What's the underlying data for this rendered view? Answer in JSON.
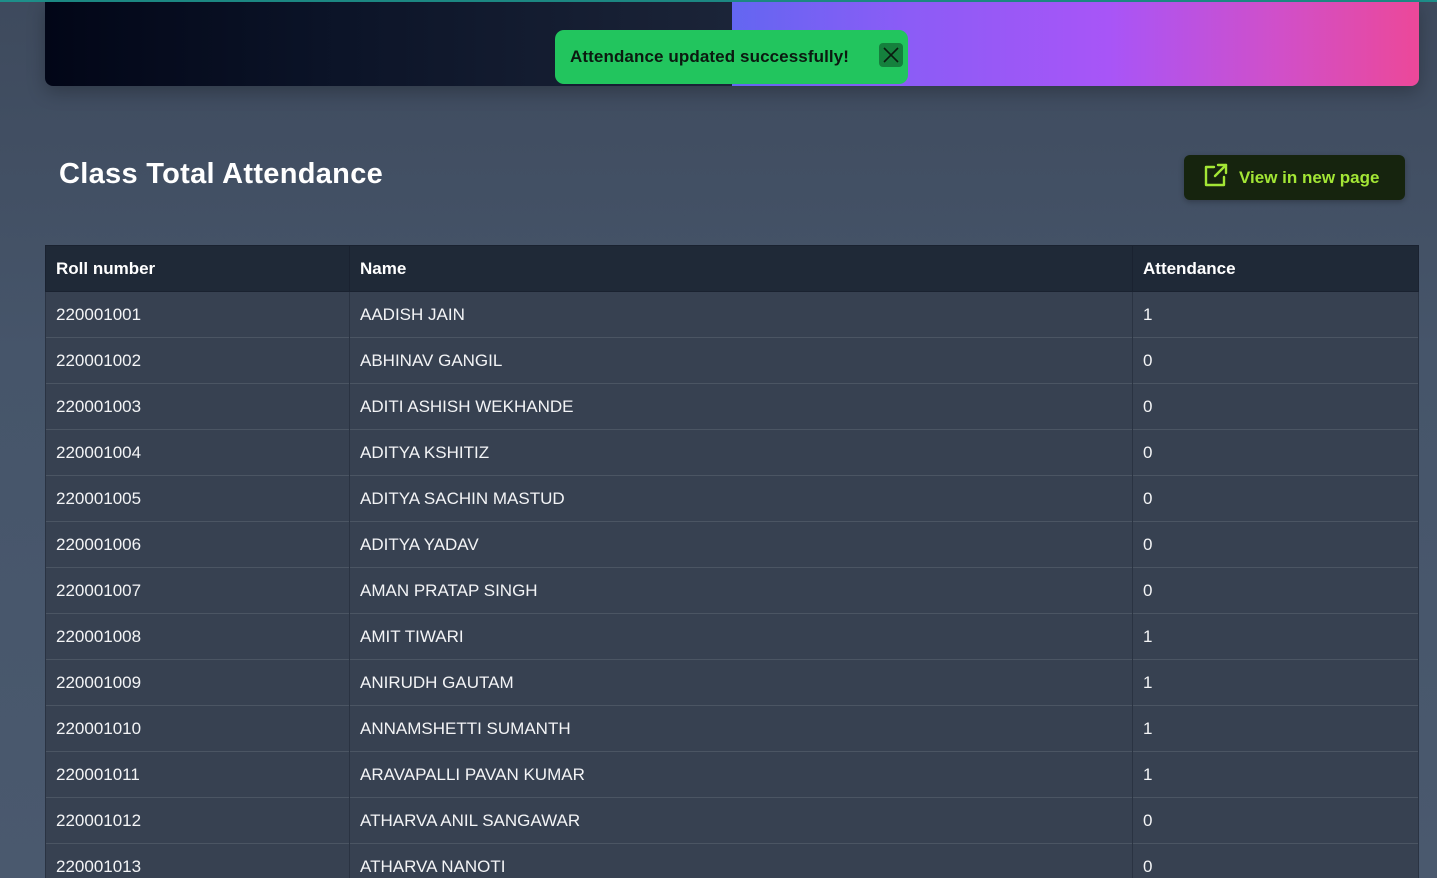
{
  "toast": {
    "message": "Attendance updated successfully!"
  },
  "page": {
    "title": "Class Total Attendance",
    "view_button_label": "View in new page"
  },
  "table": {
    "headers": [
      "Roll number",
      "Name",
      "Attendance"
    ],
    "rows": [
      {
        "roll": "220001001",
        "name": "AADISH JAIN",
        "attendance": "1"
      },
      {
        "roll": "220001002",
        "name": "ABHINAV GANGIL",
        "attendance": "0"
      },
      {
        "roll": "220001003",
        "name": "ADITI ASHISH WEKHANDE",
        "attendance": "0"
      },
      {
        "roll": "220001004",
        "name": "ADITYA KSHITIZ",
        "attendance": "0"
      },
      {
        "roll": "220001005",
        "name": "ADITYA SACHIN MASTUD",
        "attendance": "0"
      },
      {
        "roll": "220001006",
        "name": "ADITYA YADAV",
        "attendance": "0"
      },
      {
        "roll": "220001007",
        "name": "AMAN PRATAP SINGH",
        "attendance": "0"
      },
      {
        "roll": "220001008",
        "name": "AMIT TIWARI",
        "attendance": "1"
      },
      {
        "roll": "220001009",
        "name": "ANIRUDH GAUTAM",
        "attendance": "1"
      },
      {
        "roll": "220001010",
        "name": "ANNAMSHETTI SUMANTH",
        "attendance": "1"
      },
      {
        "roll": "220001011",
        "name": "ARAVAPALLI PAVAN KUMAR",
        "attendance": "1"
      },
      {
        "roll": "220001012",
        "name": "ATHARVA ANIL SANGAWAR",
        "attendance": "0"
      },
      {
        "roll": "220001013",
        "name": "ATHARVA NANOTI",
        "attendance": "0"
      }
    ]
  },
  "icons": {
    "close": "close-icon",
    "external_link": "external-link-icon"
  },
  "colors": {
    "toast_bg": "#22c55e",
    "button_text": "#a3e635",
    "header_bg": "#1f2937",
    "row_bg": "#374151"
  }
}
